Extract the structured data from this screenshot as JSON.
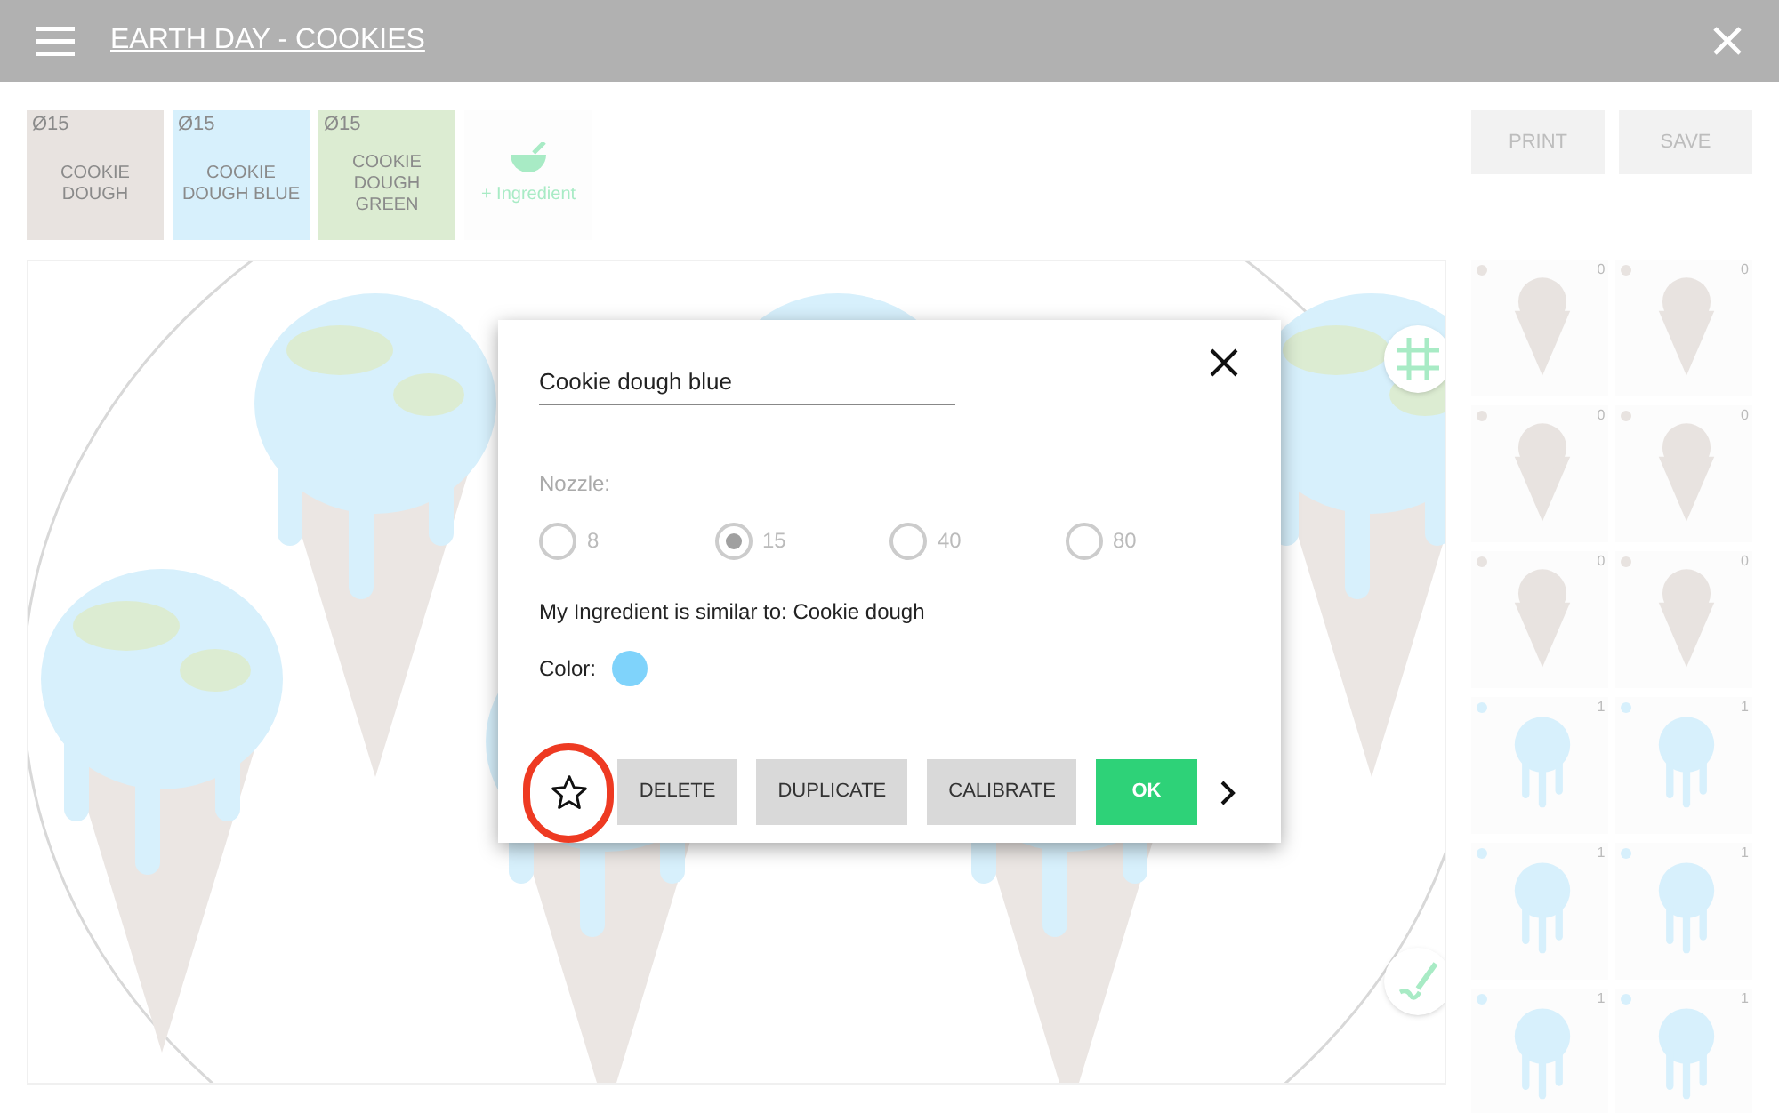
{
  "header": {
    "title": "EARTH DAY - COOKIES"
  },
  "ingredients": [
    {
      "nozzle": "Ø15",
      "name": "COOKIE DOUGH",
      "color": "#e8e3e0"
    },
    {
      "nozzle": "Ø15",
      "name": "COOKIE DOUGH BLUE",
      "color": "#d7f0fc"
    },
    {
      "nozzle": "Ø15",
      "name": "COOKIE DOUGH GREEN",
      "color": "#dcecd2"
    }
  ],
  "add_ingredient": "+ Ingredient",
  "actions": [
    "PRINT",
    "SAVE"
  ],
  "thumbnails": [
    {
      "kind": "cone",
      "color": "#e8e3e0",
      "count": "0"
    },
    {
      "kind": "cone",
      "color": "#e8e3e0",
      "count": "0"
    },
    {
      "kind": "cone",
      "color": "#e8e3e0",
      "count": "0"
    },
    {
      "kind": "cone",
      "color": "#e8e3e0",
      "count": "0"
    },
    {
      "kind": "cone",
      "color": "#e8e3e0",
      "count": "0"
    },
    {
      "kind": "cone",
      "color": "#e8e3e0",
      "count": "0"
    },
    {
      "kind": "drip",
      "color": "#d7f0fc",
      "count": "1"
    },
    {
      "kind": "drip",
      "color": "#d7f0fc",
      "count": "1"
    },
    {
      "kind": "drip",
      "color": "#d7f0fc",
      "count": "1"
    },
    {
      "kind": "drip",
      "color": "#d7f0fc",
      "count": "1"
    },
    {
      "kind": "drip",
      "color": "#d7f0fc",
      "count": "1"
    },
    {
      "kind": "drip",
      "color": "#d7f0fc",
      "count": "1"
    }
  ],
  "dialog": {
    "name": "Cookie dough blue",
    "nozzle_label": "Nozzle:",
    "nozzles": [
      {
        "label": "8",
        "selected": false
      },
      {
        "label": "15",
        "selected": true
      },
      {
        "label": "40",
        "selected": false
      },
      {
        "label": "80",
        "selected": false
      }
    ],
    "similar": "My Ingredient is similar to: Cookie dough",
    "color_label": "Color:",
    "color": "#7fd3fb",
    "buttons": [
      {
        "kind": "star",
        "highlighted": true
      },
      {
        "kind": "plain",
        "label": "DELETE"
      },
      {
        "kind": "plain",
        "label": "DUPLICATE"
      },
      {
        "kind": "plain",
        "label": "CALIBRATE"
      },
      {
        "kind": "primary",
        "label": "OK"
      },
      {
        "kind": "next"
      }
    ]
  }
}
